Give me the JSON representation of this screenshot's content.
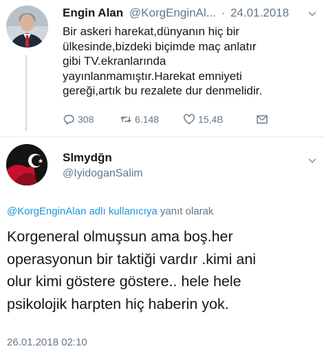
{
  "parent_tweet": {
    "author_name": "Engin Alan",
    "handle": "@KorgEnginAl...",
    "separator": "·",
    "date": "24.01.2018",
    "text_lines": [
      "Bir askeri harekat,dünyanın hiç bir",
      "ülkesinde,bizdeki biçimde maç anlatır",
      "gibi TV.ekranlarında",
      "yayınlanmamıştır.Harekat emniyeti",
      "gereği,artık bu rezalete dur denmelidir."
    ],
    "actions": {
      "reply_count": "308",
      "retweet_count": "6.148",
      "like_count": "15,4B",
      "reply_icon": "reply-icon",
      "retweet_icon": "retweet-icon",
      "like_icon": "heart-icon",
      "dm_icon": "envelope-icon"
    }
  },
  "reply_tweet": {
    "author_name": "Slmydğn",
    "handle": "@IyidoganSalim",
    "reply_to_mention": "@KorgEnginAlan adlı kullanıcıya",
    "reply_to_suffix": "yanıt olarak",
    "text_lines": [
      "Korgeneral olmuşsun ama boş.her",
      "operasyonun bir taktiği vardır .kimi ani",
      "olur kimi göstere göstere.. hele hele",
      "psikolojik harpten hiç haberin yok."
    ],
    "timestamp": "26.01.2018 02:10"
  },
  "colors": {
    "text": "#14171a",
    "secondary": "#657786",
    "link": "#1b95e0",
    "divider": "#e6ecf0"
  }
}
